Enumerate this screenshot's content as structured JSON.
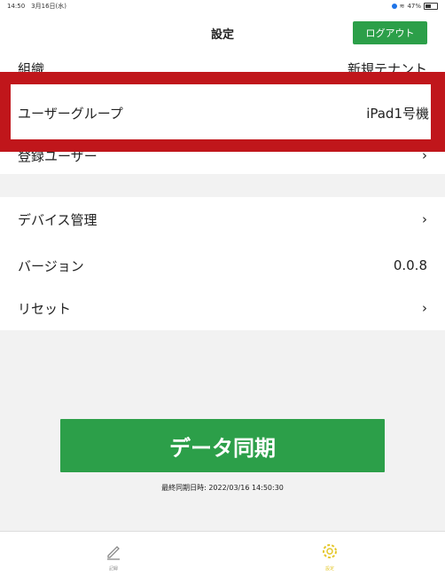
{
  "status_bar": {
    "time_date": "14:50　3月16日(水)",
    "battery": "47%"
  },
  "nav": {
    "title": "設定",
    "logout_label": "ログアウト"
  },
  "rows": {
    "organization": {
      "label": "組織",
      "value": "新規テナント"
    },
    "user_group": {
      "label": "ユーザーグループ",
      "value": "iPad1号機"
    },
    "registered_user": {
      "label": "登録ユーザー",
      "value": "›"
    },
    "device_management": {
      "label": "デバイス管理",
      "value": "›"
    },
    "version": {
      "label": "バージョン",
      "value": "0.0.8"
    },
    "reset": {
      "label": "リセット",
      "value": "›"
    }
  },
  "sync": {
    "button_label": "データ同期",
    "last_sync": "最終同期日時: 2022/03/16 14:50:30"
  },
  "tabs": [
    {
      "label": "記録",
      "icon": "pencil-icon",
      "active": false
    },
    {
      "label": "設定",
      "icon": "gear-icon",
      "active": true
    }
  ],
  "colors": {
    "accent_green": "#2c9f49",
    "highlight_red": "#c0161b",
    "active_tab": "#e4c72a"
  }
}
